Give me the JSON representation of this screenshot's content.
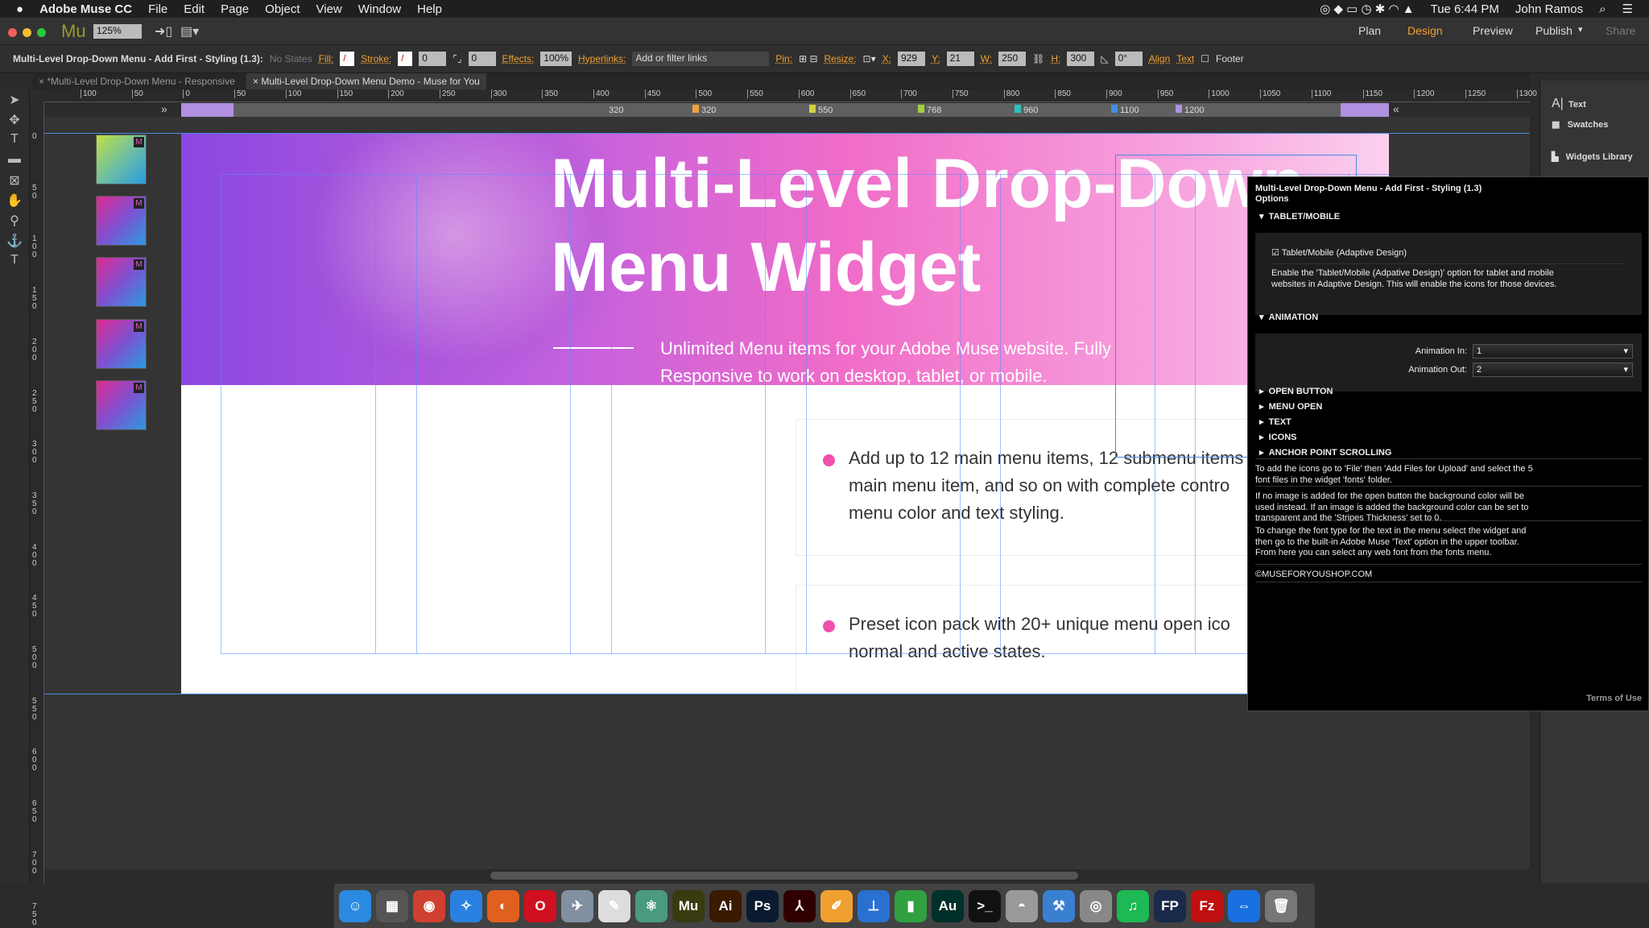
{
  "menubar": {
    "apple": "",
    "app": "Adobe Muse CC",
    "items": [
      "File",
      "Edit",
      "Page",
      "Object",
      "View",
      "Window",
      "Help"
    ],
    "clock": "Tue 6:44 PM",
    "user": "John Ramos"
  },
  "appbar": {
    "logo": "Mu",
    "zoom": "125%",
    "modes": [
      "Plan",
      "Design",
      "Preview",
      "Publish",
      "Share"
    ],
    "active_mode": "Design"
  },
  "controlbar": {
    "selection": "Multi-Level Drop-Down Menu - Add First - Styling (1.3):",
    "states": "No States",
    "fill": "Fill:",
    "stroke": "Stroke:",
    "stroke_value": "0",
    "corner_value": "0",
    "effects": "Effects:",
    "opacity": "100%",
    "hyperlinks": "Hyperlinks:",
    "hyperlinks_placeholder": "Add or filter links",
    "pin": "Pin:",
    "resize": "Resize:",
    "x_label": "X:",
    "x": "929",
    "y_label": "Y:",
    "y": "21",
    "w_label": "W:",
    "w": "250",
    "h_label": "H:",
    "h": "300",
    "rotation": "0°",
    "align": "Align",
    "text": "Text",
    "footer": "Footer"
  },
  "tabs": [
    {
      "label": "*Multi-Level Drop-Down Menu - Responsive",
      "active": false
    },
    {
      "label": "Multi-Level Drop-Down Menu Demo - Muse for You",
      "active": true
    }
  ],
  "ruler": {
    "ticks": [
      "100",
      "50",
      "0",
      "50",
      "100",
      "150",
      "200",
      "250",
      "300",
      "350",
      "400",
      "450",
      "500",
      "550",
      "600",
      "650",
      "700",
      "750",
      "800",
      "850",
      "900",
      "950",
      "1000",
      "1050",
      "1100",
      "1150",
      "1200",
      "1250",
      "1300"
    ]
  },
  "vruler": {
    "ticks": [
      "0",
      "50",
      "100",
      "150",
      "200",
      "250",
      "300",
      "350",
      "400",
      "450",
      "500",
      "550",
      "600",
      "650",
      "700",
      "750"
    ]
  },
  "breakpoints": {
    "labels": [
      "320",
      "320",
      "550",
      "768",
      "960",
      "1100",
      "1200"
    ],
    "colors": [
      "#f0a040",
      "#d0d040",
      "#a0d040",
      "#30c0c0",
      "#4090e0",
      "#b090e0"
    ],
    "active": "1200"
  },
  "hero": {
    "title_line1": "Multi-Level Drop-Down",
    "title_line2": "Menu Widget",
    "subtitle": "Unlimited Menu items for your Adobe Muse website. Fully Responsive to work on desktop, tablet, or mobile."
  },
  "features": [
    {
      "lines": [
        "Add up to 12 main menu items, 12 submenu items",
        "main menu item, and so on with complete contro",
        "menu color and text styling."
      ]
    },
    {
      "lines": [
        "Preset icon pack with 20+ unique menu open ico",
        "normal and active states."
      ]
    }
  ],
  "thumbs": {
    "badge": "M"
  },
  "rpanel": {
    "items": [
      "Text",
      "Swatches",
      "Widgets Library"
    ]
  },
  "popup": {
    "title": "Multi-Level Drop-Down Menu - Add First - Styling (1.3)",
    "subtitle": "Options",
    "tablet": {
      "header": "TABLET/MOBILE",
      "checkbox": "Tablet/Mobile (Adaptive Design)",
      "checked": true,
      "desc": "Enable the 'Tablet/Mobile (Adpative Design)' option for tablet and mobile websites in Adaptive Design. This will enable the icons for those devices."
    },
    "animation": {
      "header": "ANIMATION",
      "in_label": "Animation In:",
      "in_value": "1",
      "out_label": "Animation Out:",
      "out_value": "2"
    },
    "collapsed": [
      "OPEN BUTTON",
      "MENU OPEN",
      "TEXT",
      "ICONS",
      "ANCHOR POINT SCROLLING"
    ],
    "notes": [
      "To add the icons go to 'File' then 'Add Files for Upload' and select the 5 font files in the widget 'fonts' folder.",
      "If no image is added for the open button the background color will be used instead. If an image is added the background color can be set to transparent and the 'Stripes Thickness' set to 0.",
      "To change the font type for the text in the menu select the widget and then go to the built-in Adobe Muse 'Text' option in the upper toolbar. From here you can select any web font from the fonts menu."
    ],
    "copyright": "©MUSEFORYOUSHOP.COM",
    "terms": "Terms of Use"
  },
  "dock": [
    {
      "name": "finder",
      "label": "☺",
      "color": "#2a8ae0"
    },
    {
      "name": "launchpad",
      "label": "▦",
      "color": "#555"
    },
    {
      "name": "chrome",
      "label": "◉",
      "color": "#d04030"
    },
    {
      "name": "safari",
      "label": "✧",
      "color": "#2a80e0"
    },
    {
      "name": "firefox",
      "label": "◐",
      "color": "#e06020"
    },
    {
      "name": "opera",
      "label": "O",
      "color": "#d01020"
    },
    {
      "name": "preview",
      "label": "✈",
      "color": "#8090a0"
    },
    {
      "name": "textedit",
      "label": "✎",
      "color": "#ddd"
    },
    {
      "name": "atom",
      "label": "⚛",
      "color": "#4a9a80"
    },
    {
      "name": "muse",
      "label": "Mu",
      "color": "#3a3a10"
    },
    {
      "name": "illustrator",
      "label": "Ai",
      "color": "#3a1a00"
    },
    {
      "name": "photoshop",
      "label": "Ps",
      "color": "#0a1a30"
    },
    {
      "name": "acrobat",
      "label": "⅄",
      "color": "#300000"
    },
    {
      "name": "pages",
      "label": "✐",
      "color": "#f0a030"
    },
    {
      "name": "keynote",
      "label": "⊥",
      "color": "#2a70d0"
    },
    {
      "name": "numbers",
      "label": "▮",
      "color": "#30a040"
    },
    {
      "name": "audition",
      "label": "Au",
      "color": "#00302a"
    },
    {
      "name": "terminal",
      "label": ">_",
      "color": "#111"
    },
    {
      "name": "sequel",
      "label": "◓",
      "color": "#999"
    },
    {
      "name": "xcode",
      "label": "⚒",
      "color": "#3a80d0"
    },
    {
      "name": "dvd",
      "label": "◎",
      "color": "#888"
    },
    {
      "name": "spotify",
      "label": "♫",
      "color": "#1db954"
    },
    {
      "name": "fp",
      "label": "FP",
      "color": "#1a2a4a"
    },
    {
      "name": "filezilla",
      "label": "Fz",
      "color": "#c01010"
    },
    {
      "name": "teamviewer",
      "label": "⇔",
      "color": "#1a70e0"
    },
    {
      "name": "trash",
      "label": "🗑",
      "color": "#777"
    }
  ]
}
